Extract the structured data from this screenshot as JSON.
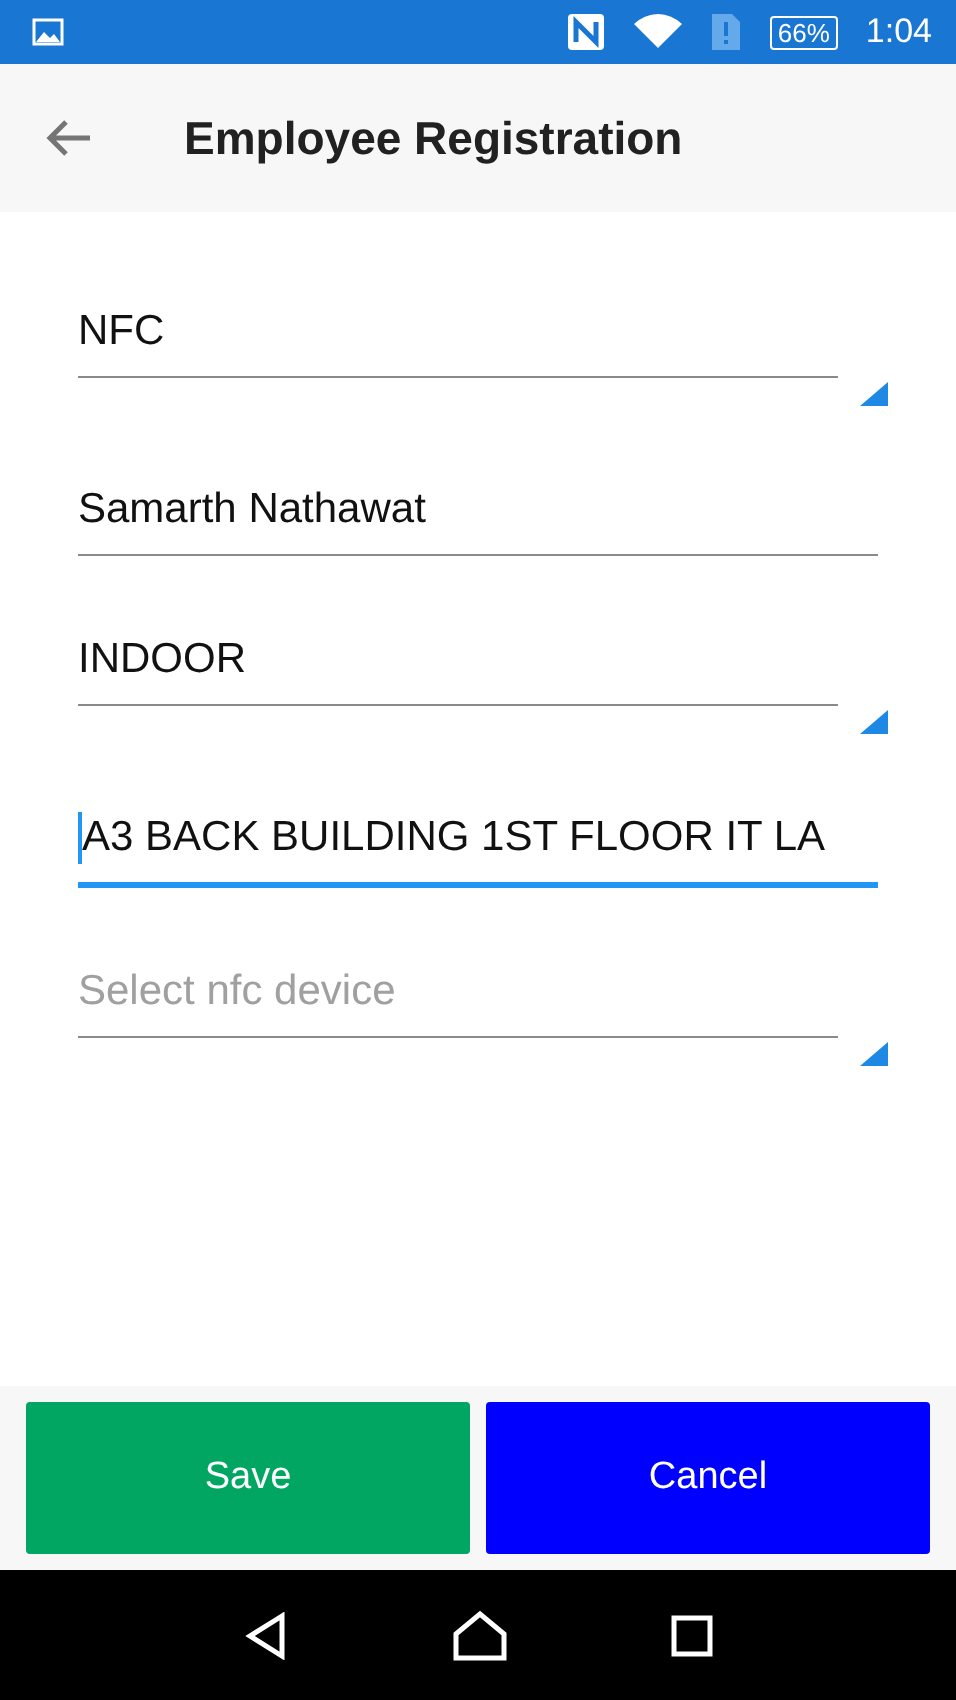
{
  "status_bar": {
    "battery": "66%",
    "time": "1:04"
  },
  "app_bar": {
    "title": "Employee Registration"
  },
  "fields": [
    {
      "kind": "picker",
      "value": "NFC"
    },
    {
      "kind": "text",
      "value": "Samarth Nathawat",
      "focused": false
    },
    {
      "kind": "picker",
      "value": "INDOOR"
    },
    {
      "kind": "text",
      "value": "A3 BACK BUILDING 1ST FLOOR IT LA",
      "focused": true
    },
    {
      "kind": "picker",
      "placeholder": "Select nfc device"
    }
  ],
  "buttons": [
    {
      "label": "Save",
      "color": "#00a661"
    },
    {
      "label": "Cancel",
      "color": "#0000ff"
    }
  ]
}
